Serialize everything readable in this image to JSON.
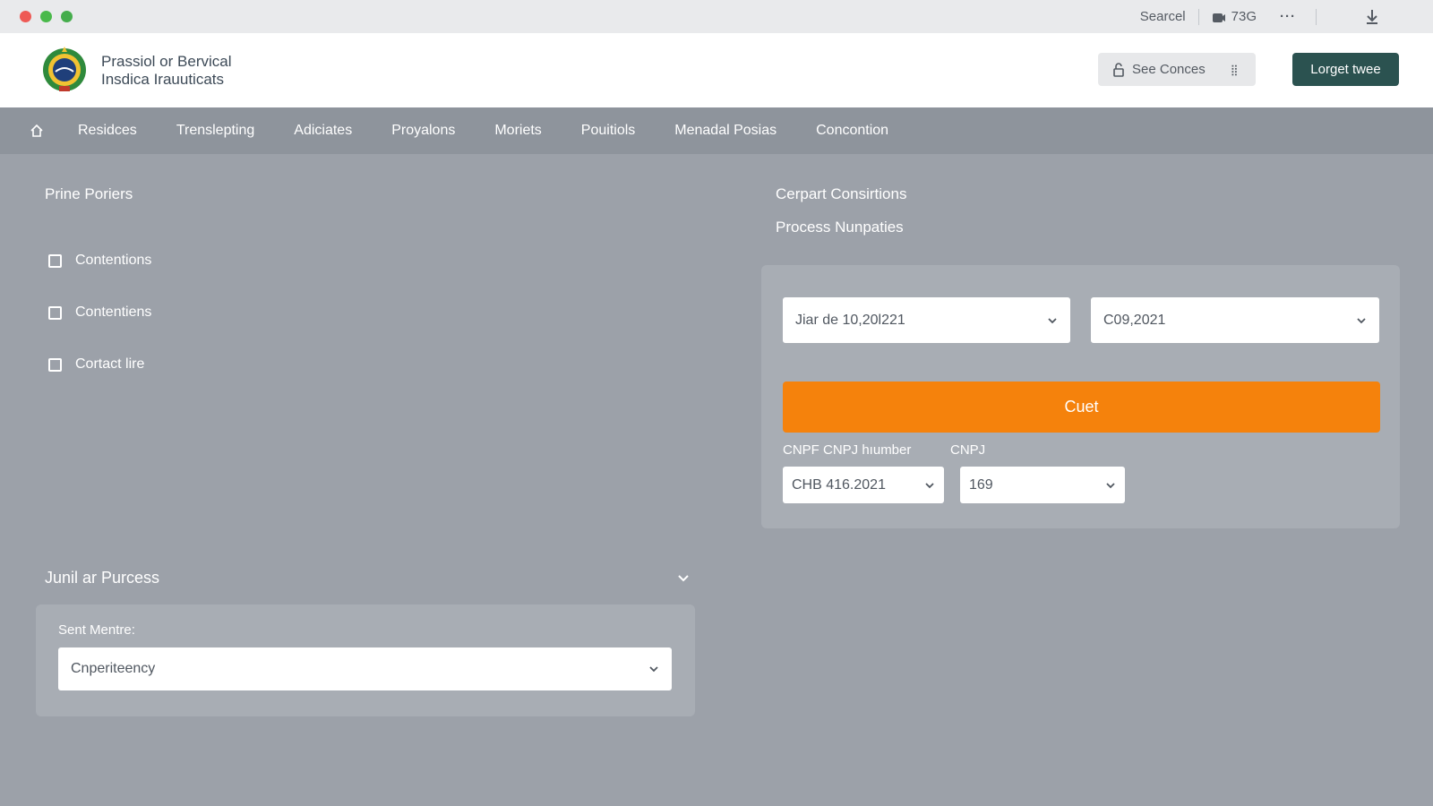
{
  "titlebar": {
    "search_label": "Searcel",
    "camera_label": "73G",
    "more_label": "···"
  },
  "header": {
    "org_line1": "Prassiol or Bervical",
    "org_line2": "Insdica Irauuticats",
    "see_button": "See Conces",
    "login_button": "Lorget twee"
  },
  "nav": {
    "items": [
      "Residces",
      "Trenslepting",
      "Adiciates",
      "Proyalons",
      "Moriets",
      "Pouitiols",
      "Menadal Posias",
      "Concontion"
    ]
  },
  "left": {
    "title": "Prine Poriers",
    "checkboxes": [
      "Contentions",
      "Contentiens",
      "Cortact lire"
    ]
  },
  "right": {
    "title1": "Cerpart Consirtions",
    "title2": "Process Nunpaties",
    "date_select_1": "Jiar de 10,20l221",
    "date_select_2": "C09,2021",
    "orange_button": "Cuet",
    "cnpf_label": "CNPF CNPJ hıumber",
    "cnpj_label": "CNPJ",
    "cnpf_select": "CHB 416.2021",
    "cnpj_select": "169"
  },
  "junil": {
    "title": "Junil ar Purcess",
    "field_label": "Sent Mentre:",
    "field_value": "Cnperiteency"
  },
  "colors": {
    "accent_orange": "#f5820c",
    "login_green": "#2b5250",
    "page_bg": "#9ca1a9",
    "nav_bg": "#8e949c"
  }
}
